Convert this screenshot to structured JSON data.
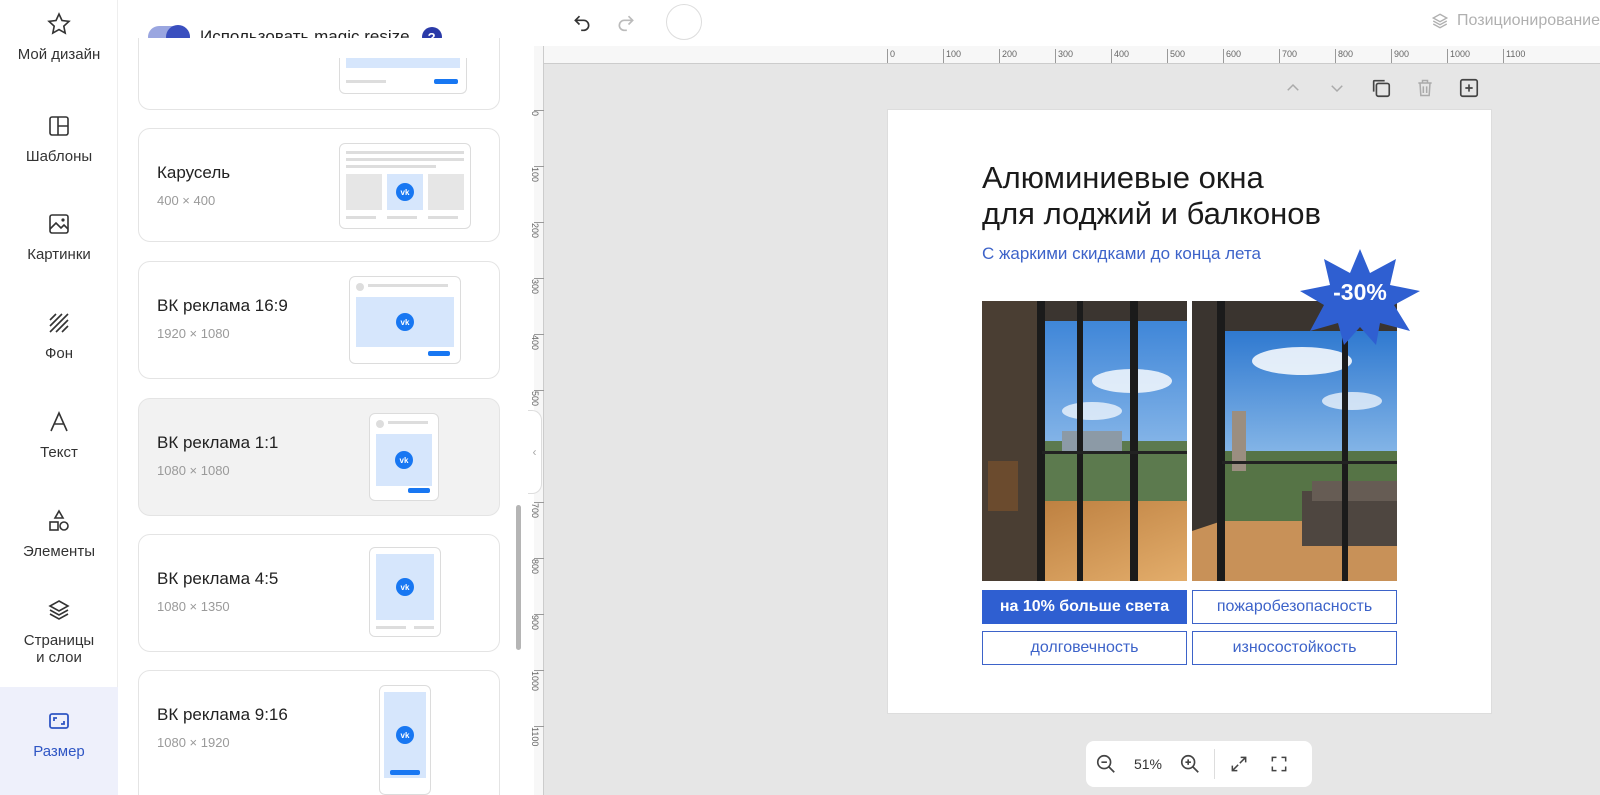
{
  "rail": {
    "items": [
      {
        "label": "Мой дизайн",
        "icon": "star-icon"
      },
      {
        "label": "Шаблоны",
        "icon": "templates-icon"
      },
      {
        "label": "Картинки",
        "icon": "image-icon"
      },
      {
        "label": "Фон",
        "icon": "background-icon"
      },
      {
        "label": "Текст",
        "icon": "text-icon"
      },
      {
        "label": "Элементы",
        "icon": "shapes-icon"
      },
      {
        "label": "Страницы",
        "label2": "и слои",
        "icon": "layers-icon"
      },
      {
        "label": "Размер",
        "icon": "resize-icon",
        "active": true
      }
    ]
  },
  "panel": {
    "magic_resize_label": "Использовать magic resize",
    "help_glyph": "?",
    "formats": [
      {
        "title": "Карусель",
        "size": "400 × 400"
      },
      {
        "title": "ВК реклама 16:9",
        "size": "1920 × 1080"
      },
      {
        "title": "ВК реклама 1:1",
        "size": "1080 × 1080",
        "selected": true
      },
      {
        "title": "ВК реклама 4:5",
        "size": "1080 × 1350"
      },
      {
        "title": "ВК реклама 9:16",
        "size": "1080 × 1920"
      }
    ]
  },
  "toolbar": {
    "positioning_label": "Позиционирование"
  },
  "ruler": {
    "h_ticks": [
      "0",
      "100",
      "200",
      "300",
      "400",
      "500",
      "600",
      "700",
      "800",
      "900",
      "1000",
      "1100"
    ],
    "v_ticks": [
      "0",
      "100",
      "200",
      "300",
      "400",
      "500",
      "700",
      "800",
      "900",
      "1000",
      "1100"
    ]
  },
  "design": {
    "headline_line1": "Алюминиевые окна",
    "headline_line2": "для лоджий и балконов",
    "subline": "С жаркими скидками до конца лета",
    "discount": "-30%",
    "chips": [
      "на 10% больше света",
      "пожаробезопасность",
      "долговечность",
      "износостойкость"
    ]
  },
  "zoom": {
    "value": "51%"
  },
  "colors": {
    "accent": "#2f5fd1",
    "active_rail": "#2f56c4",
    "burst": "#2f5fd1"
  }
}
